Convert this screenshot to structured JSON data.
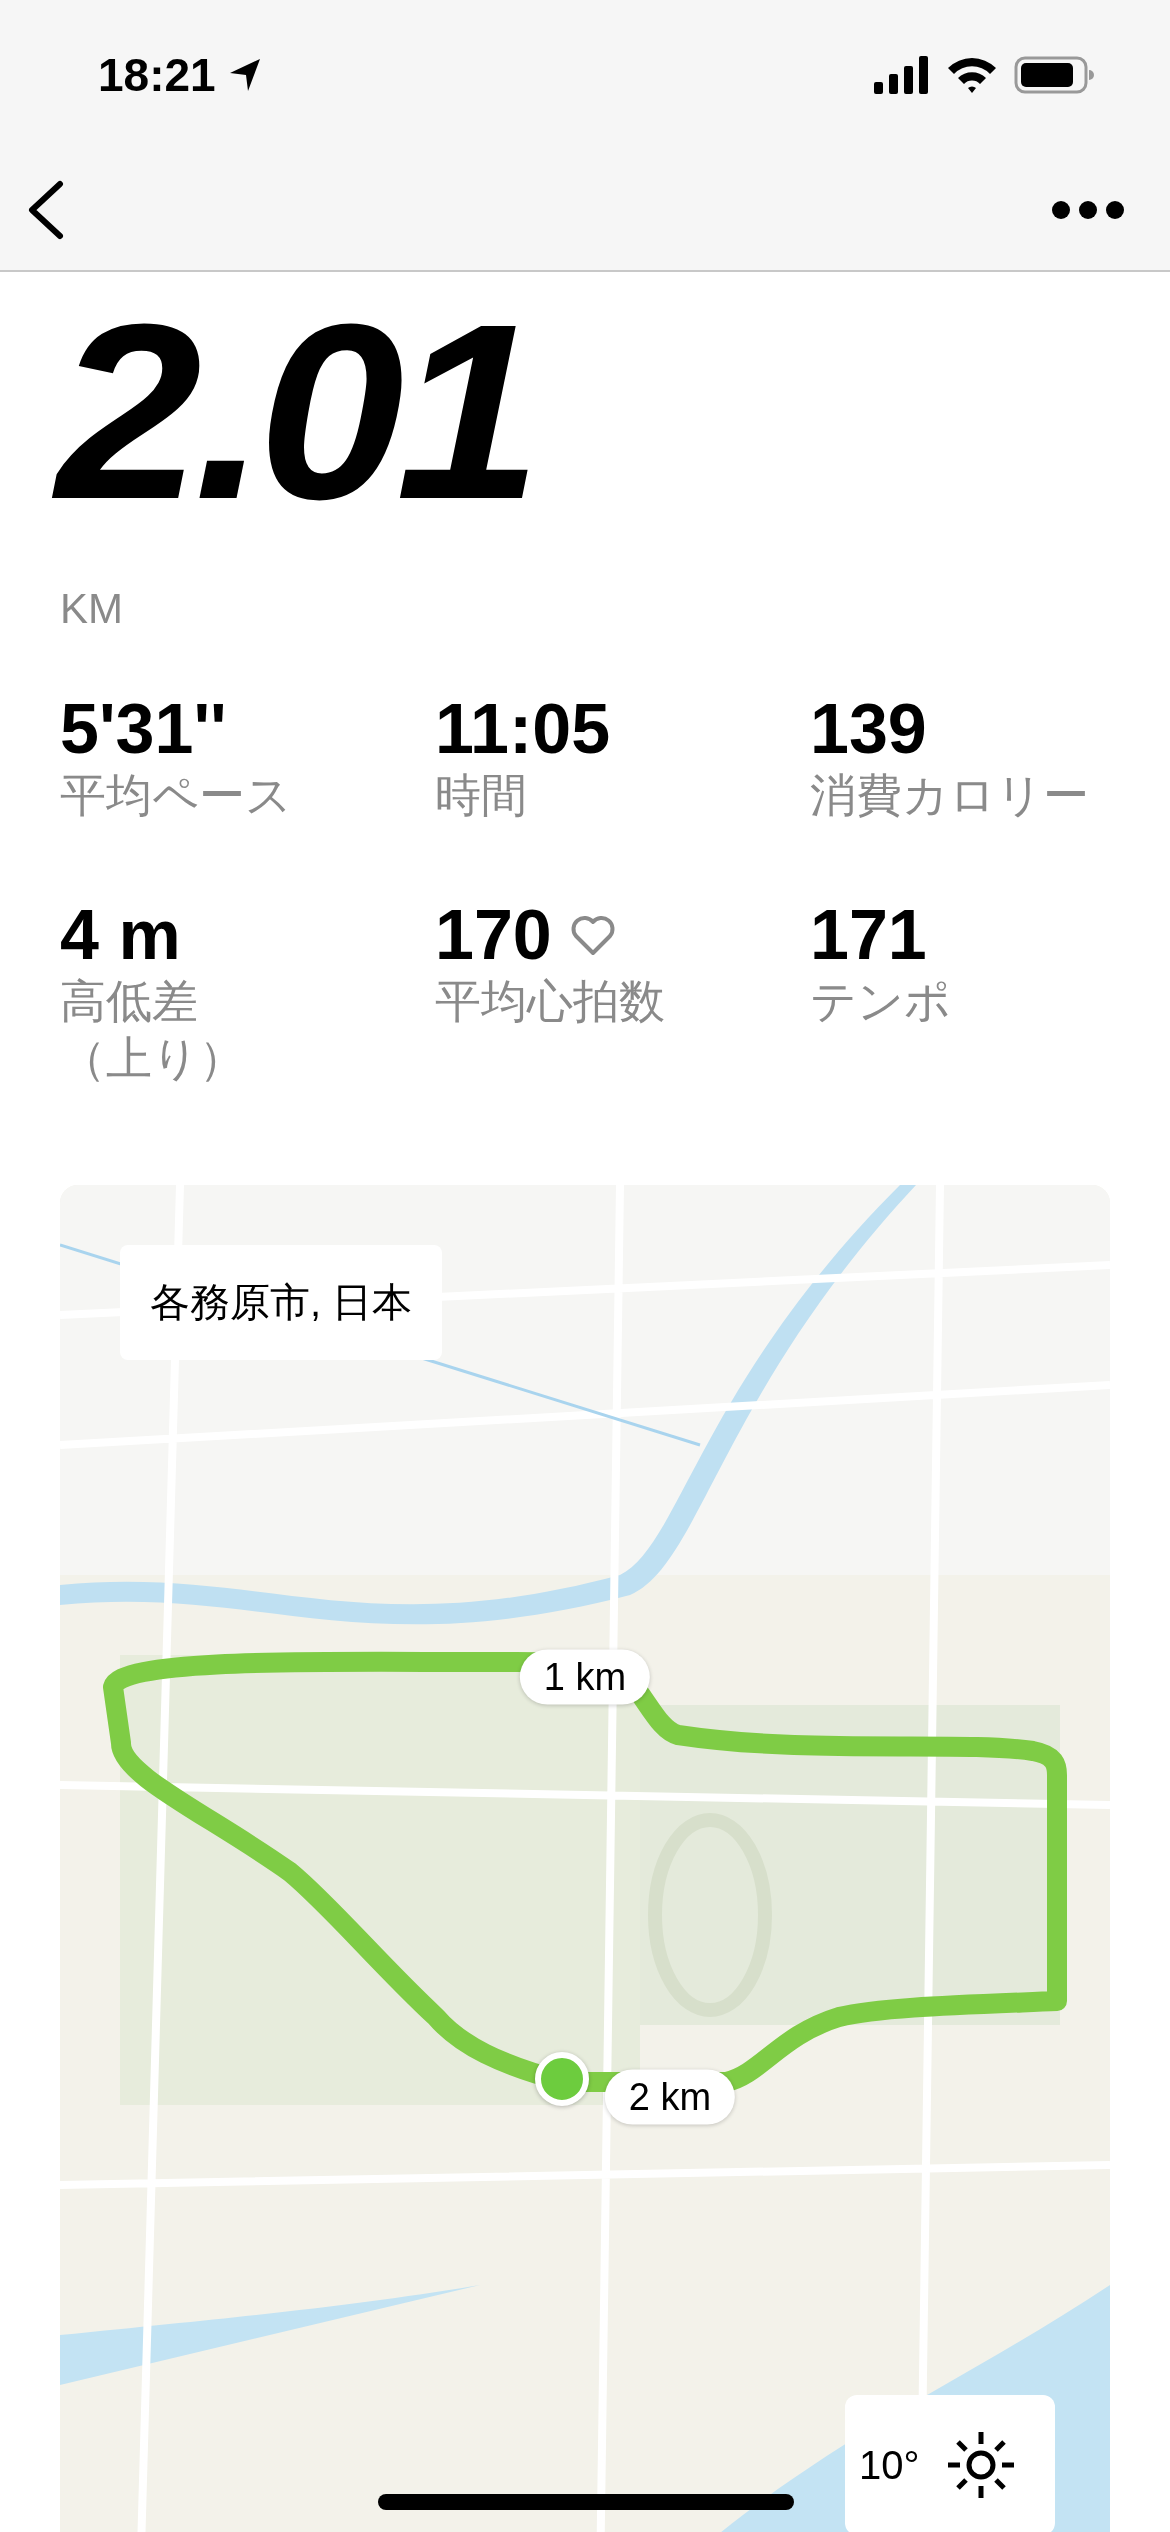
{
  "status_bar": {
    "time": "18:21"
  },
  "distance": {
    "value": "2.01",
    "unit": "KM"
  },
  "stats": [
    {
      "value": "5'31''",
      "label": "平均ペース",
      "kind": "plain"
    },
    {
      "value": "11:05",
      "label": "時間",
      "kind": "plain"
    },
    {
      "value": "139",
      "label": "消費カロリー",
      "kind": "plain"
    },
    {
      "value": "4 m",
      "label": "高低差",
      "label_2": "（上り）",
      "kind": "plain"
    },
    {
      "value": "170",
      "label": "平均心拍数",
      "kind": "heart"
    },
    {
      "value": "171",
      "label": "テンポ",
      "kind": "plain"
    }
  ],
  "map": {
    "location": "各務原市, 日本",
    "markers": [
      {
        "label": "1 km"
      },
      {
        "label": "2 km"
      }
    ],
    "weather": {
      "temperature": "10°"
    }
  }
}
